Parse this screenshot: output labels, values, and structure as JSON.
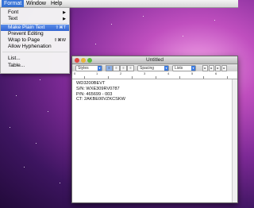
{
  "menubar": {
    "items": [
      {
        "label": "Format",
        "active": true
      },
      {
        "label": "Window",
        "active": false
      },
      {
        "label": "Help",
        "active": false
      }
    ]
  },
  "format_menu": {
    "items": [
      {
        "label": "Font",
        "submenu": true,
        "highlighted": false
      },
      {
        "label": "Text",
        "submenu": true,
        "highlighted": false
      },
      {
        "label": "Make Plain Text",
        "shortcut": "⇧⌘T",
        "highlighted": true
      },
      {
        "label": "Prevent Editing",
        "highlighted": false
      },
      {
        "label": "Wrap to Page",
        "shortcut": "⇧⌘W",
        "highlighted": false
      },
      {
        "label": "Allow Hyphenation",
        "highlighted": false
      },
      {
        "label": "List...",
        "highlighted": false
      },
      {
        "label": "Table...",
        "highlighted": false
      }
    ]
  },
  "window": {
    "title": "Untitled",
    "toolbar": {
      "styles": "Styles",
      "spacing": "Spacing",
      "lists": "Lists"
    },
    "ruler": [
      "0",
      "1",
      "2",
      "3",
      "4",
      "5",
      "6"
    ],
    "lines": [
      "WD3200BEVT",
      "S/N: WXE309RV0787",
      "P/N: 465699 - 003",
      "CT: 2AKBE00VZKCSKW"
    ]
  },
  "colors": {
    "highlight": "#3465d2",
    "desktop": "#8a2ba0"
  }
}
